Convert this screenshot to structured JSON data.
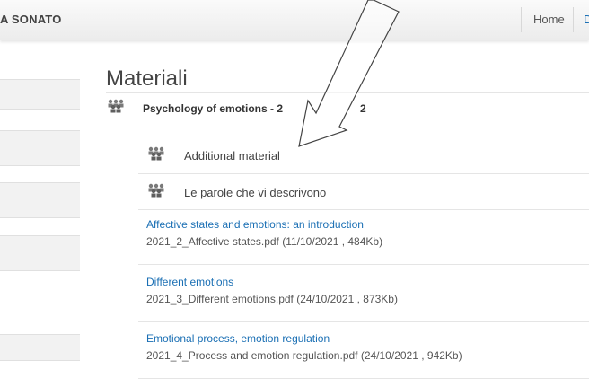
{
  "header": {
    "brand": "A SONATO",
    "nav": {
      "home": "Home",
      "next": "D"
    }
  },
  "main": {
    "heading": "Materiali",
    "course": {
      "title": "Psychology of emotions - 2",
      "title_suffix": "2"
    },
    "folders": [
      {
        "label": "Additional material",
        "icon": "people-folder-icon"
      },
      {
        "label": "Le parole che vi descrivono",
        "icon": "people-folder-icon"
      }
    ],
    "files": [
      {
        "title": "Affective states and emotions: an introduction",
        "info": "2021_2_Affective states.pdf (11/10/2021 , 484Kb)"
      },
      {
        "title": "Different emotions",
        "info": "2021_3_Different emotions.pdf (24/10/2021 , 873Kb)"
      },
      {
        "title": "Emotional process, emotion regulation",
        "info": "2021_4_Process and emotion regulation.pdf (24/10/2021 , 942Kb)"
      }
    ]
  },
  "colors": {
    "link": "#1a6fb4",
    "icon": "#6b6b6b",
    "sidebar": "#f2f2f2"
  },
  "overlay": {
    "icon": "arrow-annotation-icon"
  }
}
